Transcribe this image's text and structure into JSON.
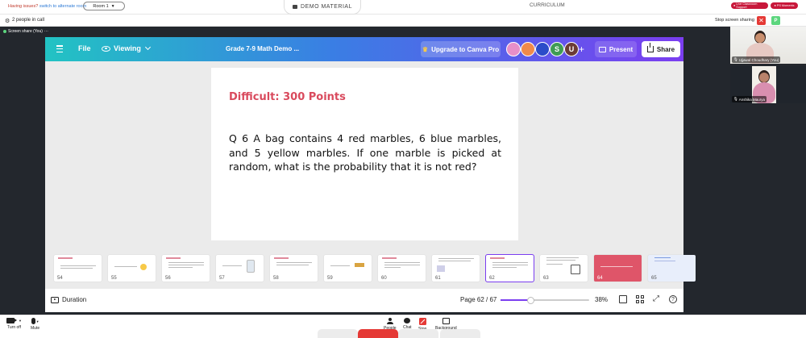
{
  "topbar": {
    "issues_text": "Having issues?",
    "alternate_link": "switch to alternate room",
    "room_value": "Room 1",
    "demo_material": "DEMO MATERIAL",
    "curriculum": "CURRICULUM",
    "support_button": "Live Classroom Support",
    "moments_button": "PS Moments"
  },
  "participants": {
    "count_text": "2 people in call",
    "stop_sharing": "Stop screen sharing",
    "close_symbol": "✕",
    "user_initial": "P"
  },
  "share_tab": {
    "label": "Screen share (You)",
    "menu": "···"
  },
  "canva": {
    "file_label": "File",
    "viewing_label": "Viewing",
    "doc_title": "Grade 7-9 Math Demo ...",
    "upgrade_label": "Upgrade to Canva Pro",
    "avatars": [
      "",
      "",
      "",
      "S",
      "U"
    ],
    "plus": "+",
    "present_label": "Present",
    "share_label": "Share",
    "colors": {
      "gradient_start": "#22c3c3",
      "gradient_mid": "#3a7ee4",
      "gradient_end": "#7b3ef0",
      "heading": "#d94a5d"
    }
  },
  "slide": {
    "heading": "Difficult: 300 Points",
    "question": "Q 6 A bag contains 4 red marbles, 6 blue marbles, and 5 yellow marbles. If one marble is picked at random, what is the probability that it is not red?"
  },
  "thumbnails": [
    {
      "num": "54"
    },
    {
      "num": "55"
    },
    {
      "num": "56"
    },
    {
      "num": "57"
    },
    {
      "num": "58"
    },
    {
      "num": "59"
    },
    {
      "num": "60"
    },
    {
      "num": "61"
    },
    {
      "num": "62"
    },
    {
      "num": "63"
    },
    {
      "num": "64"
    },
    {
      "num": "65"
    }
  ],
  "canva_bottom": {
    "duration_label": "Duration",
    "page_indicator": "Page 62 / 67",
    "zoom_fraction": 0.34,
    "zoom_value": "38%",
    "help_symbol": "?"
  },
  "videos": [
    {
      "name": "Ujjawal Choudhary (You)"
    },
    {
      "name": "Anshika Maurya"
    }
  ],
  "meetbar": {
    "camera_label": "Turn off",
    "mic_label": "Mute",
    "people_label": "People",
    "chat_label": "Chat",
    "stop_label": "Stop",
    "background_label": "Background"
  }
}
